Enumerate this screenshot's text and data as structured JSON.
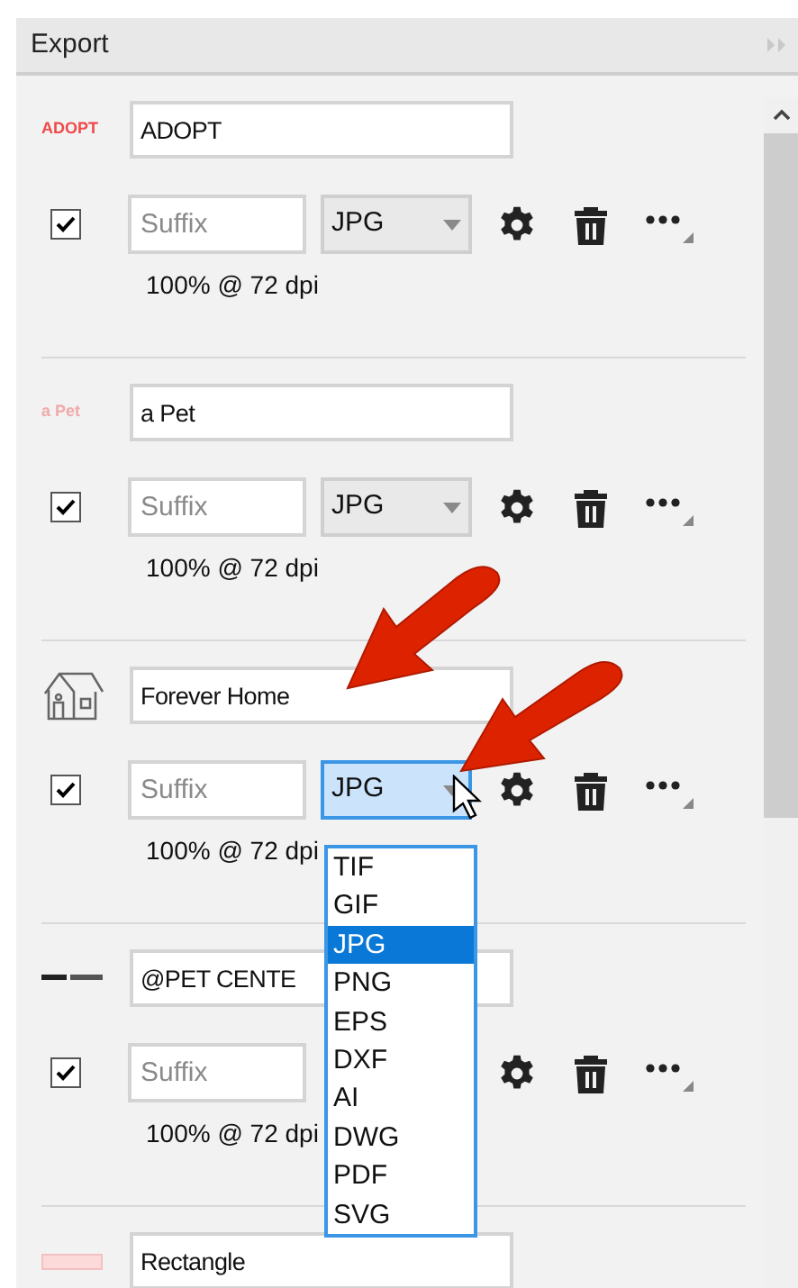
{
  "panel": {
    "title": "Export"
  },
  "items": [
    {
      "thumb": {
        "kind": "wordmark",
        "text": "ADOPT",
        "color": "#f04a4a"
      },
      "name": "ADOPT",
      "checked": true,
      "suffix_placeholder": "Suffix",
      "format": "JPG",
      "format_focused": false,
      "resolution": "100% @ 72 dpi"
    },
    {
      "thumb": {
        "kind": "wordmark",
        "text": "a Pet",
        "color": "#f2a9a9"
      },
      "name": "a Pet",
      "checked": true,
      "suffix_placeholder": "Suffix",
      "format": "JPG",
      "format_focused": false,
      "resolution": "100% @ 72 dpi"
    },
    {
      "thumb": {
        "kind": "house"
      },
      "name": "Forever Home",
      "checked": true,
      "suffix_placeholder": "Suffix",
      "format": "JPG",
      "format_focused": true,
      "resolution": "100% @ 72 dpi",
      "format_menu": [
        {
          "label": "TIF",
          "selected": false
        },
        {
          "label": "GIF",
          "selected": false
        },
        {
          "label": "JPG",
          "selected": true
        },
        {
          "label": "PNG",
          "selected": false
        },
        {
          "label": "EPS",
          "selected": false
        },
        {
          "label": "DXF",
          "selected": false
        },
        {
          "label": "AI",
          "selected": false
        },
        {
          "label": "DWG",
          "selected": false
        },
        {
          "label": "PDF",
          "selected": false
        },
        {
          "label": "SVG",
          "selected": false
        }
      ]
    },
    {
      "thumb": {
        "kind": "tinymark"
      },
      "name": "@PET CENTE",
      "checked": true,
      "suffix_placeholder": "Suffix",
      "resolution": "100% @ 72 dpi"
    },
    {
      "thumb": {
        "kind": "rectangle"
      },
      "name": "Rectangle"
    }
  ]
}
